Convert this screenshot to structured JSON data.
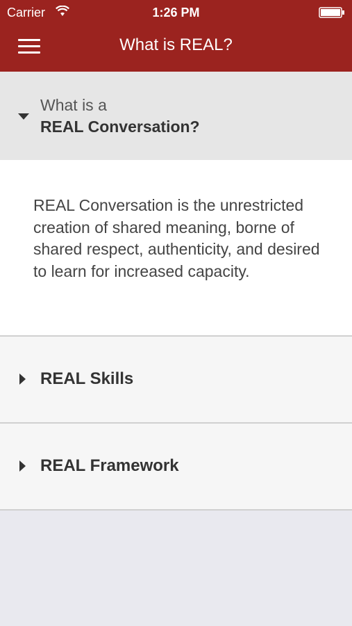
{
  "status_bar": {
    "carrier": "Carrier",
    "time": "1:26 PM",
    "wifi_icon": "wifi-icon",
    "battery_icon": "battery-icon"
  },
  "nav": {
    "title": "What is REAL?",
    "menu_icon": "hamburger-menu-icon",
    "bar_color": "#9b231f"
  },
  "sections": {
    "expanded": {
      "question_line1": "What is a",
      "question_line2": "REAL Conversation?",
      "answer": "REAL Conversation is the unrestricted creation of shared meaning, borne of shared respect, authenticity, and desired to learn for increased capacity.",
      "icon": "caret-down-icon"
    },
    "collapsed": [
      {
        "label": "REAL Skills",
        "icon": "caret-right-icon"
      },
      {
        "label": "REAL Framework",
        "icon": "caret-right-icon"
      }
    ]
  }
}
